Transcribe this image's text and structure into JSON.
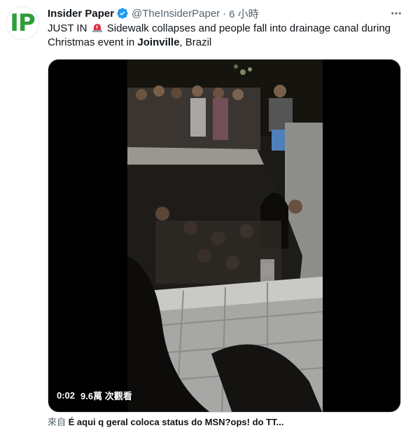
{
  "author": {
    "name": "Insider Paper",
    "handle": "@TheInsiderPaper",
    "separator": "·",
    "time": "6 小時",
    "avatar_text": "IP"
  },
  "tweet": {
    "text_part1": "JUST IN",
    "text_part2": "Sidewalk collapses and people fall into drainage canal during Christmas event in",
    "bold_place": "Joinville",
    "text_part3": ", Brazil"
  },
  "video": {
    "elapsed": "0:02",
    "views": "9.6萬 次觀看"
  },
  "source": {
    "prefix": "來自",
    "app": "É aqui q geral coloca status do MSN?ops! do TT..."
  },
  "icons": {
    "verified": "verified-badge-icon",
    "more": "more-options-icon",
    "siren": "siren-emoji-icon"
  },
  "colors": {
    "accent": "#1d9bf0",
    "text": "#0f1419",
    "muted": "#536471",
    "brand_green": "#2e9e3a"
  }
}
